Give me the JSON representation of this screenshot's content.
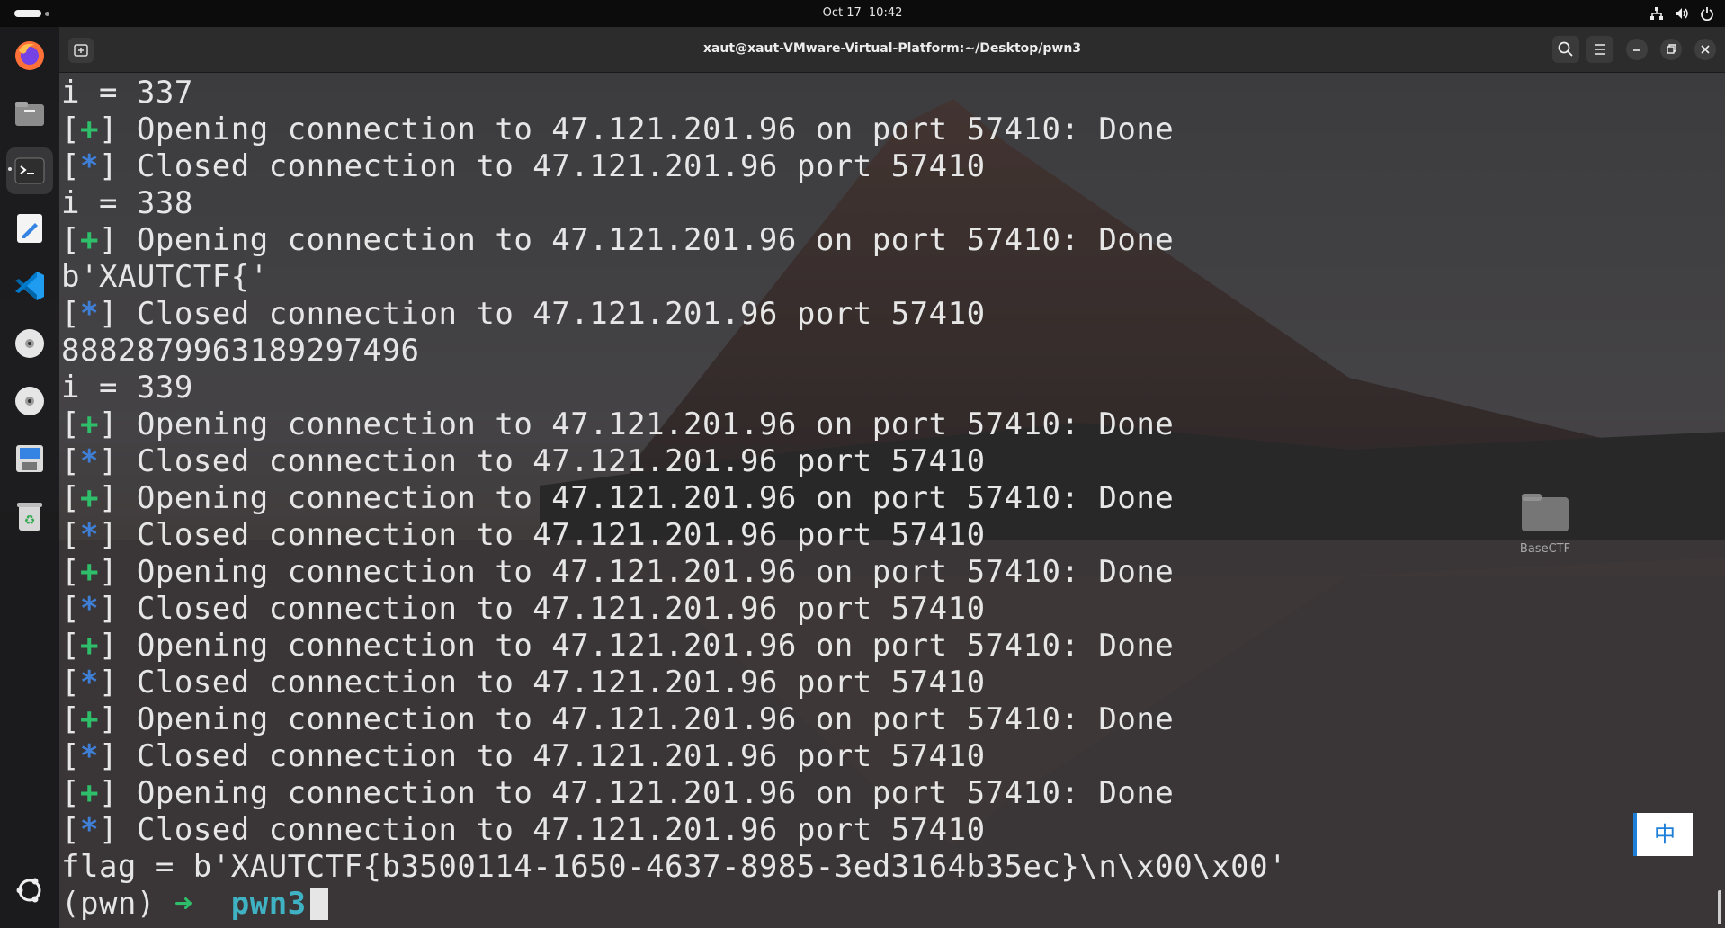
{
  "topbar": {
    "date": "Oct 17",
    "time": "10:42",
    "tray_icons": [
      "network-icon",
      "volume-icon",
      "power-icon"
    ]
  },
  "dock": {
    "items": [
      {
        "name": "firefox",
        "icon": "firefox-icon"
      },
      {
        "name": "files",
        "icon": "files-icon"
      },
      {
        "name": "terminal",
        "icon": "terminal-icon",
        "active": true
      },
      {
        "name": "text-editor",
        "icon": "text-editor-icon"
      },
      {
        "name": "vscode",
        "icon": "vscode-icon"
      },
      {
        "name": "cdrom-1",
        "icon": "disc-icon"
      },
      {
        "name": "cdrom-2",
        "icon": "disc-icon"
      },
      {
        "name": "floppy",
        "icon": "floppy-icon"
      },
      {
        "name": "trash",
        "icon": "trash-icon"
      },
      {
        "name": "apps",
        "icon": "ubuntu-icon"
      }
    ]
  },
  "terminal": {
    "title": "xaut@xaut-VMware-Virtual-Platform:~/Desktop/pwn3",
    "lines": [
      {
        "text": "i = 337"
      },
      {
        "mark": "+",
        "text": " Opening connection to 47.121.201.96 on port 57410: Done"
      },
      {
        "mark": "*",
        "text": " Closed connection to 47.121.201.96 port 57410"
      },
      {
        "text": "i = 338"
      },
      {
        "mark": "+",
        "text": " Opening connection to 47.121.201.96 on port 57410: Done"
      },
      {
        "text": "b'XAUTCTF{'"
      },
      {
        "mark": "*",
        "text": " Closed connection to 47.121.201.96 port 57410"
      },
      {
        "text": "8882879963189297496"
      },
      {
        "text": "i = 339"
      },
      {
        "mark": "+",
        "text": " Opening connection to 47.121.201.96 on port 57410: Done"
      },
      {
        "mark": "*",
        "text": " Closed connection to 47.121.201.96 port 57410"
      },
      {
        "mark": "+",
        "text": " Opening connection to 47.121.201.96 on port 57410: Done"
      },
      {
        "mark": "*",
        "text": " Closed connection to 47.121.201.96 port 57410"
      },
      {
        "mark": "+",
        "text": " Opening connection to 47.121.201.96 on port 57410: Done"
      },
      {
        "mark": "*",
        "text": " Closed connection to 47.121.201.96 port 57410"
      },
      {
        "mark": "+",
        "text": " Opening connection to 47.121.201.96 on port 57410: Done"
      },
      {
        "mark": "*",
        "text": " Closed connection to 47.121.201.96 port 57410"
      },
      {
        "mark": "+",
        "text": " Opening connection to 47.121.201.96 on port 57410: Done"
      },
      {
        "mark": "*",
        "text": " Closed connection to 47.121.201.96 port 57410"
      },
      {
        "mark": "+",
        "text": " Opening connection to 47.121.201.96 on port 57410: Done"
      },
      {
        "mark": "*",
        "text": " Closed connection to 47.121.201.96 port 57410"
      },
      {
        "text": "flag = b'XAUTCTF{b3500114-1650-4637-8985-3ed3164b35ec}\\n\\x00\\x00'"
      }
    ],
    "prompt": {
      "env": "(pwn)",
      "arrow": "➜",
      "dir": "pwn3"
    }
  },
  "desktop": {
    "folder_label": "BaseCTF"
  },
  "ime": {
    "label": "中"
  },
  "colors": {
    "plus": "#2fbf6a",
    "star": "#3f7fd6",
    "dir": "#3fb3c4",
    "text": "#e6e6e6"
  }
}
